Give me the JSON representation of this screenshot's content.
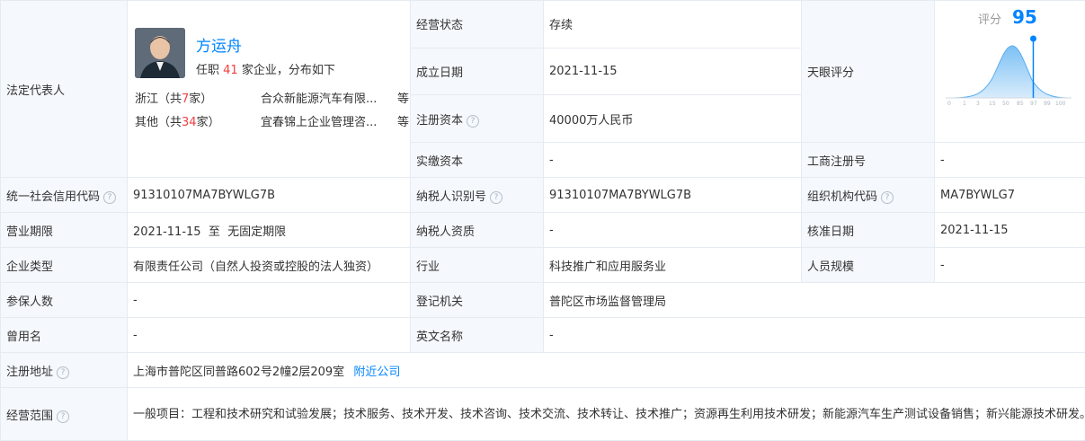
{
  "legal_rep": {
    "label": "法定代表人",
    "name": "方运舟",
    "roles_prefix": "任职",
    "roles_count": "41",
    "roles_suffix": "家企业，分布如下",
    "dist": [
      {
        "region": "浙江（共",
        "count": "7",
        "region_suffix": "家）",
        "company": "合众新能源汽车有限...",
        "suffix": "等"
      },
      {
        "region": "其他（共",
        "count": "34",
        "region_suffix": "家）",
        "company": "宜春锦上企业管理咨...",
        "suffix": "等"
      }
    ]
  },
  "right_top": [
    {
      "label": "经营状态",
      "value": "存续"
    },
    {
      "label": "成立日期",
      "value": "2021-11-15"
    },
    {
      "label": "注册资本",
      "value": "40000万人民币"
    },
    {
      "label": "实缴资本",
      "value": "-"
    }
  ],
  "tianyan": {
    "label": "天眼评分",
    "score_label": "评分",
    "score": "95",
    "score_fraction": 0.95,
    "axis": [
      "0",
      "1",
      "3",
      "15",
      "50",
      "85",
      "97",
      "99",
      "100"
    ]
  },
  "gongshang": {
    "label": "工商注册号",
    "value": "-"
  },
  "rows": {
    "credit_code": {
      "label": "统一社会信用代码",
      "value": "91310107MA7BYWLG7B"
    },
    "tax_id": {
      "label": "纳税人识别号",
      "value": "91310107MA7BYWLG7B"
    },
    "org_code": {
      "label": "组织机构代码",
      "value": "MA7BYWLG7"
    },
    "term": {
      "label": "营业期限",
      "value": "2021-11-15  至  无固定期限"
    },
    "tax_qual": {
      "label": "纳税人资质",
      "value": "-"
    },
    "approval_date": {
      "label": "核准日期",
      "value": "2021-11-15"
    },
    "type": {
      "label": "企业类型",
      "value": "有限责任公司（自然人投资或控股的法人独资）"
    },
    "industry": {
      "label": "行业",
      "value": "科技推广和应用服务业"
    },
    "staff": {
      "label": "人员规模",
      "value": "-"
    },
    "insured": {
      "label": "参保人数",
      "value": "-"
    },
    "reg_authority": {
      "label": "登记机关",
      "value": "普陀区市场监督管理局"
    },
    "former_name": {
      "label": "曾用名",
      "value": "-"
    },
    "english_name": {
      "label": "英文名称",
      "value": "-"
    },
    "address": {
      "label": "注册地址",
      "value": "上海市普陀区同普路602号2幢2层209室",
      "link": "附近公司"
    },
    "scope": {
      "label": "经营范围",
      "value": "一般项目：工程和技术研究和试验发展；技术服务、技术开发、技术咨询、技术交流、技术转让、技术推广；资源再生利用技术研发；新能源汽车生产测试设备销售；新兴能源技术研发。（除依法须经批准的项目外，凭营业执照依法自主开展经营活动）"
    }
  }
}
